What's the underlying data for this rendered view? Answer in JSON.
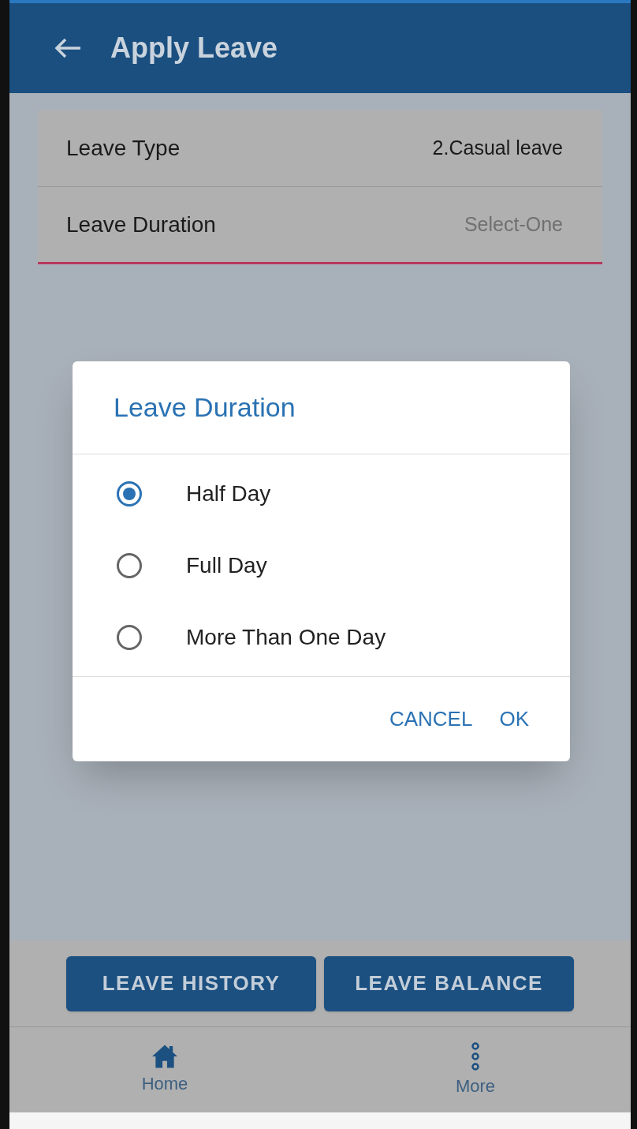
{
  "app_bar": {
    "title": "Apply Leave"
  },
  "form": {
    "fields": [
      {
        "label": "Leave Type",
        "value": "2.Casual leave",
        "kind": "value"
      },
      {
        "label": "Leave Duration",
        "value": "Select-One",
        "kind": "placeholder"
      }
    ]
  },
  "dialog": {
    "title": "Leave Duration",
    "options": [
      {
        "label": "Half Day",
        "selected": true
      },
      {
        "label": "Full Day",
        "selected": false
      },
      {
        "label": "More Than One Day",
        "selected": false
      }
    ],
    "buttons": [
      "CANCEL",
      "OK"
    ]
  },
  "actions": [
    "LEAVE HISTORY",
    "LEAVE BALANCE"
  ],
  "bottom_nav": [
    {
      "label": "Home",
      "kind": "home"
    },
    {
      "label": "More",
      "kind": "more"
    }
  ]
}
